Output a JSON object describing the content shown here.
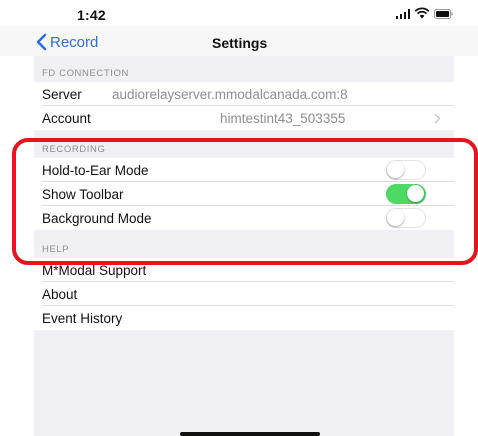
{
  "status_bar": {
    "time": "1:42",
    "icons": [
      "signal-icon",
      "wifi-icon",
      "battery-icon"
    ]
  },
  "nav": {
    "back_label": "Record",
    "title": "Settings",
    "accent_color": "#2a6fe0"
  },
  "sections": {
    "fd_connection": {
      "header": "FD CONNECTION",
      "server_label": "Server",
      "server_value": "audiorelayserver.mmodalcanada.com:8",
      "account_label": "Account",
      "account_value": "himtestint43_503355"
    },
    "recording": {
      "header": "RECORDING",
      "items": [
        {
          "label": "Hold-to-Ear Mode",
          "toggle": "off"
        },
        {
          "label": "Show Toolbar",
          "toggle": "on"
        },
        {
          "label": "Background Mode",
          "toggle": "off"
        }
      ]
    },
    "help": {
      "header": "HELP",
      "items": [
        {
          "label": "M*Modal Support"
        },
        {
          "label": "About"
        },
        {
          "label": "Event History"
        }
      ]
    }
  },
  "colors": {
    "toggle_on": "#4cd964",
    "annotation": "#e8131c",
    "group_background": "#efeff4"
  }
}
